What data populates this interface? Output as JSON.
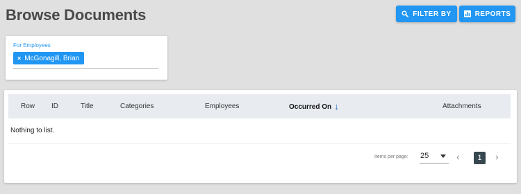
{
  "page": {
    "title": "Browse Documents"
  },
  "toolbar": {
    "filter_label": "FILTER BY",
    "reports_label": "REPORTS"
  },
  "filter": {
    "label": "For Employees",
    "chip_remove": "×",
    "chip_label": "McGonagill, Brian"
  },
  "table": {
    "columns": {
      "row": "Row",
      "id": "ID",
      "title": "Title",
      "categories": "Categories",
      "employees": "Employees",
      "occurred_on": "Occurred On",
      "attachments": "Attachments"
    },
    "sort_indicator": "↓",
    "empty_message": "Nothing to list."
  },
  "pagination": {
    "items_per_page_label": "Items per page:",
    "items_per_page": "25",
    "prev": "‹",
    "current_page": "1",
    "next": "›"
  },
  "colors": {
    "accent": "#2196f3",
    "page_bg": "#e0e0e0",
    "header_bg": "#e8ebf0",
    "active_page": "#37474f"
  },
  "icons": {
    "filter": "search-icon",
    "reports": "bar-chart-icon",
    "sort": "arrow-down-icon",
    "dropdown": "caret-down-icon"
  }
}
